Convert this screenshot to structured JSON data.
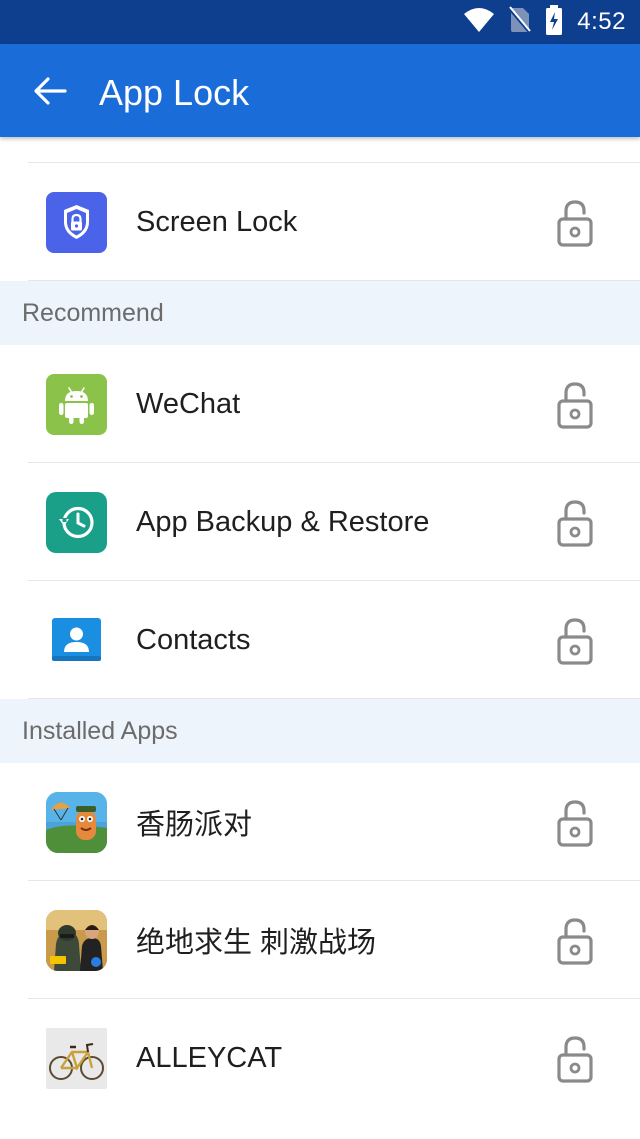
{
  "status_bar": {
    "time": "4:52",
    "icons": [
      "wifi-icon",
      "no-sim-icon",
      "battery-charging-icon"
    ]
  },
  "header": {
    "back_icon": "arrow-left-icon",
    "title": "App Lock"
  },
  "top_items": [
    {
      "label": "Screen Lock",
      "icon": "shield-lock-icon",
      "lock_state": "unlocked"
    }
  ],
  "sections": [
    {
      "title": "Recommend",
      "items": [
        {
          "label": "WeChat",
          "icon": "android-icon",
          "lock_state": "unlocked"
        },
        {
          "label": "App Backup & Restore",
          "icon": "backup-restore-icon",
          "lock_state": "unlocked"
        },
        {
          "label": "Contacts",
          "icon": "contacts-icon",
          "lock_state": "unlocked"
        }
      ]
    },
    {
      "title": "Installed Apps",
      "items": [
        {
          "label": "香肠派对",
          "icon": "sausage-party-game-icon",
          "lock_state": "unlocked"
        },
        {
          "label": "绝地求生 刺激战场",
          "icon": "pubg-game-icon",
          "lock_state": "unlocked"
        },
        {
          "label": "ALLEYCAT",
          "icon": "bicycle-icon",
          "lock_state": "unlocked"
        }
      ]
    }
  ],
  "colors": {
    "status_bar": "#0e3f8f",
    "app_bar": "#1a6cd8",
    "section_header_bg": "#eef4fb",
    "lock_icon": "#8a8a8a"
  }
}
